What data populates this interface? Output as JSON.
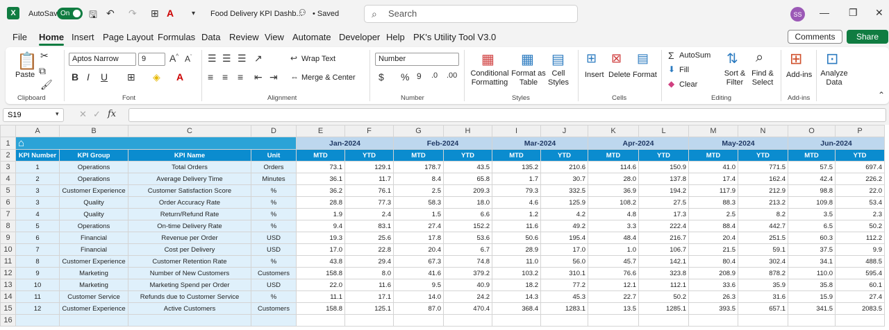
{
  "titlebar": {
    "autosave_label": "AutoSave",
    "autosave_state": "On",
    "doc_title": "Food Delivery KPI Dashb...",
    "saved_status": "• Saved",
    "search_placeholder": "Search",
    "user_initials": "SS"
  },
  "menu": [
    "File",
    "Home",
    "Insert",
    "Page Layout",
    "Formulas",
    "Data",
    "Review",
    "View",
    "Automate",
    "Developer",
    "Help",
    "PK's Utility Tool V3.0"
  ],
  "menu_active": "Home",
  "buttons": {
    "comments": "Comments",
    "share": "Share"
  },
  "ribbon": {
    "clipboard": {
      "label": "Clipboard",
      "paste": "Paste"
    },
    "font": {
      "label": "Font",
      "name": "Aptos Narrow",
      "size": "9"
    },
    "alignment": {
      "label": "Alignment",
      "wrap": "Wrap Text",
      "merge": "Merge & Center"
    },
    "number": {
      "label": "Number",
      "format": "Number"
    },
    "styles": {
      "label": "Styles",
      "cond1": "Conditional",
      "cond2": "Formatting",
      "fmt1": "Format as",
      "fmt2": "Table",
      "cell1": "Cell",
      "cell2": "Styles"
    },
    "cells": {
      "label": "Cells",
      "insert": "Insert",
      "delete": "Delete",
      "format": "Format"
    },
    "editing": {
      "label": "Editing",
      "autosum": "AutoSum",
      "fill": "Fill",
      "clear": "Clear",
      "sort1": "Sort &",
      "sort2": "Filter",
      "find1": "Find &",
      "find2": "Select"
    },
    "addins": {
      "label": "Add-ins",
      "btn": "Add-ins"
    },
    "analyze": {
      "btn1": "Analyze",
      "btn2": "Data"
    }
  },
  "formula_bar": {
    "cell_ref": "S19",
    "fx": "fx",
    "value": ""
  },
  "columns": [
    "A",
    "B",
    "C",
    "D",
    "E",
    "F",
    "G",
    "H",
    "I",
    "J",
    "K",
    "L",
    "M",
    "N",
    "O",
    "P"
  ],
  "row_numbers": [
    "1",
    "2",
    "3",
    "4",
    "5",
    "6",
    "7",
    "8",
    "9",
    "10",
    "11",
    "12",
    "13",
    "14",
    "15",
    "16"
  ],
  "sheet": {
    "months": [
      "Jan-2024",
      "Feb-2024",
      "Mar-2024",
      "Apr-2024",
      "May-2024",
      "Jun-2024"
    ],
    "headers": [
      "KPI Number",
      "KPI Group",
      "KPI Name",
      "Unit"
    ],
    "mtd": "MTD",
    "ytd": "YTD",
    "rows": [
      [
        "1",
        "Operations",
        "Total Orders",
        "Orders",
        "73.1",
        "129.1",
        "178.7",
        "43.5",
        "135.2",
        "210.6",
        "114.6",
        "150.9",
        "41.0",
        "771.5",
        "57.5",
        "697.4"
      ],
      [
        "2",
        "Operations",
        "Average Delivery Time",
        "Minutes",
        "36.1",
        "11.7",
        "8.4",
        "65.8",
        "1.7",
        "30.7",
        "28.0",
        "137.8",
        "17.4",
        "162.4",
        "42.4",
        "226.2"
      ],
      [
        "3",
        "Customer Experience",
        "Customer Satisfaction Score",
        "%",
        "36.2",
        "76.1",
        "2.5",
        "209.3",
        "79.3",
        "332.5",
        "36.9",
        "194.2",
        "117.9",
        "212.9",
        "98.8",
        "22.0"
      ],
      [
        "3",
        "Quality",
        "Order Accuracy Rate",
        "%",
        "28.8",
        "77.3",
        "58.3",
        "18.0",
        "4.6",
        "125.9",
        "108.2",
        "27.5",
        "88.3",
        "213.2",
        "109.8",
        "53.4"
      ],
      [
        "4",
        "Quality",
        "Return/Refund Rate",
        "%",
        "1.9",
        "2.4",
        "1.5",
        "6.6",
        "1.2",
        "4.2",
        "4.8",
        "17.3",
        "2.5",
        "8.2",
        "3.5",
        "2.3"
      ],
      [
        "5",
        "Operations",
        "On-time Delivery Rate",
        "%",
        "9.4",
        "83.1",
        "27.4",
        "152.2",
        "11.6",
        "49.2",
        "3.3",
        "222.4",
        "88.4",
        "442.7",
        "6.5",
        "50.2"
      ],
      [
        "6",
        "Financial",
        "Revenue per Order",
        "USD",
        "19.3",
        "25.6",
        "17.8",
        "53.6",
        "50.6",
        "195.4",
        "48.4",
        "216.7",
        "20.4",
        "251.5",
        "60.3",
        "112.2"
      ],
      [
        "7",
        "Financial",
        "Cost per Delivery",
        "USD",
        "17.0",
        "22.8",
        "20.4",
        "6.7",
        "28.9",
        "17.0",
        "1.0",
        "106.7",
        "21.5",
        "59.1",
        "37.5",
        "9.9"
      ],
      [
        "8",
        "Customer Experience",
        "Customer Retention Rate",
        "%",
        "43.8",
        "29.4",
        "67.3",
        "74.8",
        "11.0",
        "56.0",
        "45.7",
        "142.1",
        "80.4",
        "302.4",
        "34.1",
        "488.5"
      ],
      [
        "9",
        "Marketing",
        "Number of New Customers",
        "Customers",
        "158.8",
        "8.0",
        "41.6",
        "379.2",
        "103.2",
        "310.1",
        "76.6",
        "323.8",
        "208.9",
        "878.2",
        "110.0",
        "595.4"
      ],
      [
        "10",
        "Marketing",
        "Marketing Spend per Order",
        "USD",
        "22.0",
        "11.6",
        "9.5",
        "40.9",
        "18.2",
        "77.2",
        "12.1",
        "112.1",
        "33.6",
        "35.9",
        "35.8",
        "60.1"
      ],
      [
        "11",
        "Customer Service",
        "Refunds due to Customer Service",
        "%",
        "11.1",
        "17.1",
        "14.0",
        "24.2",
        "14.3",
        "45.3",
        "22.7",
        "50.2",
        "26.3",
        "31.6",
        "15.9",
        "27.4"
      ],
      [
        "12",
        "Customer Experience",
        "Active Customers",
        "Customers",
        "158.8",
        "125.1",
        "87.0",
        "470.4",
        "368.4",
        "1283.1",
        "13.5",
        "1285.1",
        "393.5",
        "657.1",
        "341.5",
        "2083.5"
      ]
    ]
  }
}
